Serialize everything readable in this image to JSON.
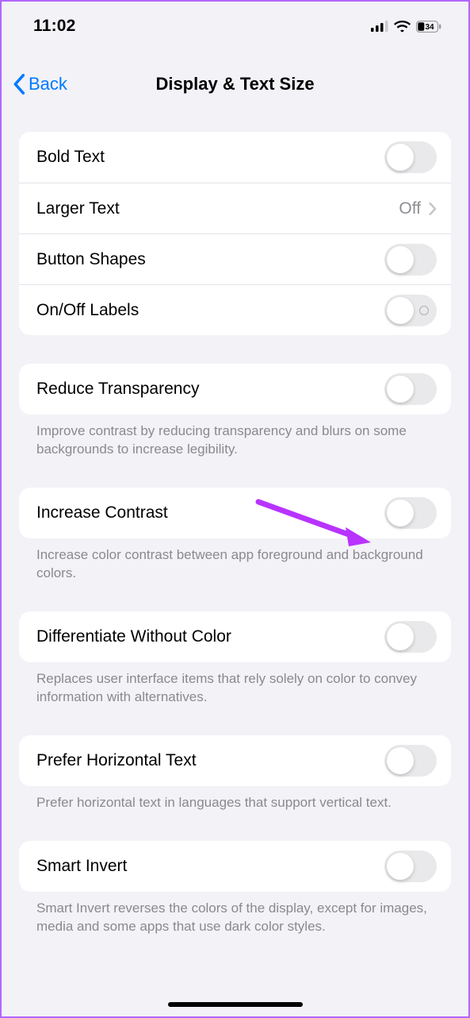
{
  "status": {
    "time": "11:02",
    "battery_text": "34"
  },
  "nav": {
    "back": "Back",
    "title": "Display & Text Size"
  },
  "group1": {
    "bold_text": "Bold Text",
    "larger_text": "Larger Text",
    "larger_text_value": "Off",
    "button_shapes": "Button Shapes",
    "onoff_labels": "On/Off Labels"
  },
  "reduce_transparency": {
    "label": "Reduce Transparency",
    "footer": "Improve contrast by reducing transparency and blurs on some backgrounds to increase legibility."
  },
  "increase_contrast": {
    "label": "Increase Contrast",
    "footer": "Increase color contrast between app foreground and background colors."
  },
  "diff_without_color": {
    "label": "Differentiate Without Color",
    "footer": "Replaces user interface items that rely solely on color to convey information with alternatives."
  },
  "prefer_horizontal": {
    "label": "Prefer Horizontal Text",
    "footer": "Prefer horizontal text in languages that support vertical text."
  },
  "smart_invert": {
    "label": "Smart Invert",
    "footer": "Smart Invert reverses the colors of the display, except for images, media and some apps that use dark color styles."
  }
}
